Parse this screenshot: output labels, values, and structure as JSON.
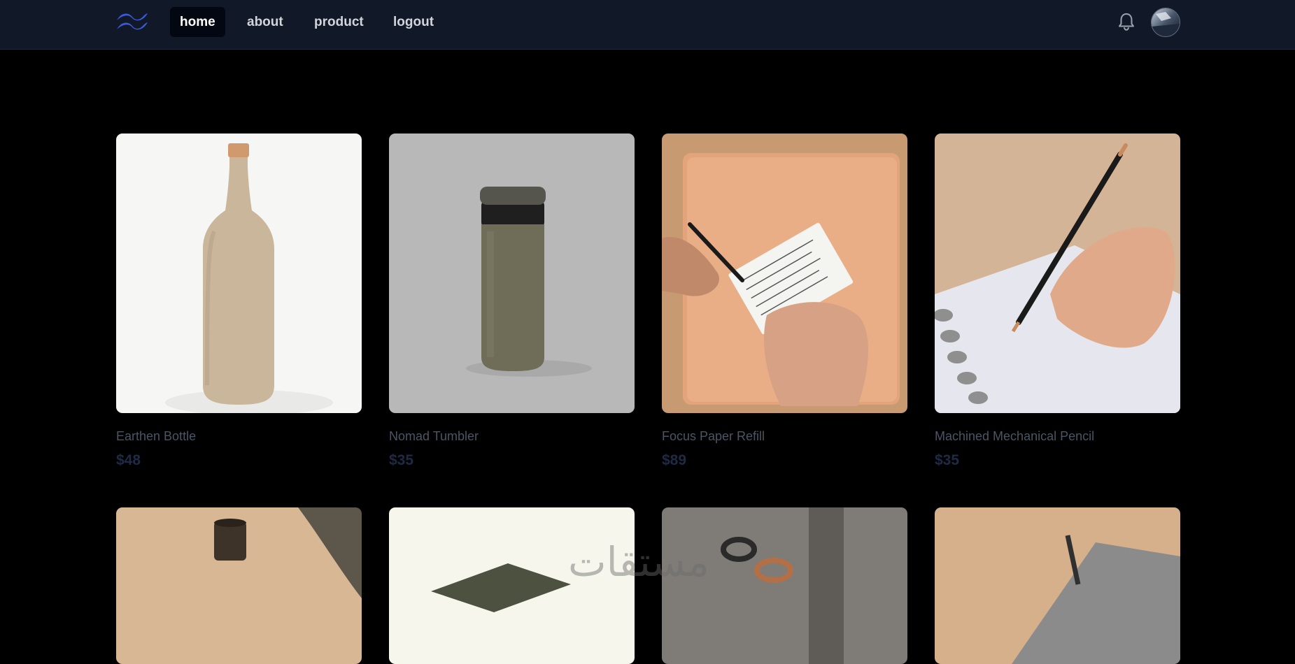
{
  "nav": {
    "links": [
      {
        "label": "home"
      },
      {
        "label": "about"
      },
      {
        "label": "product"
      },
      {
        "label": "logout"
      }
    ],
    "active": "home",
    "icons": {
      "logo": "tailwind-logo-icon",
      "notifications": "bell-icon",
      "profile": "avatar"
    }
  },
  "products": [
    {
      "name": "Earthen Bottle",
      "price": "$48"
    },
    {
      "name": "Nomad Tumbler",
      "price": "$35"
    },
    {
      "name": "Focus Paper Refill",
      "price": "$89"
    },
    {
      "name": "Machined Mechanical Pencil",
      "price": "$35"
    }
  ],
  "watermark": "مستقات",
  "colors": {
    "nav_bg": "#111827",
    "page_bg": "#000000",
    "logo": "#3b5bdb",
    "product_name": "#4b5563",
    "product_price": "#1f2a44"
  }
}
